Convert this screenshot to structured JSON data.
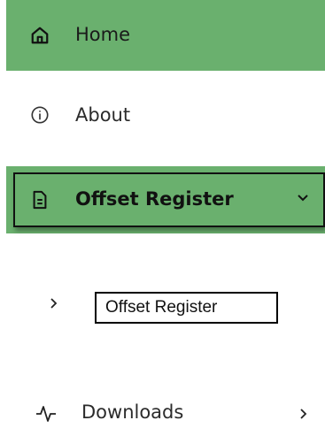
{
  "nav": {
    "home": {
      "label": "Home",
      "icon": "home-icon"
    },
    "about": {
      "label": "About",
      "icon": "info-icon"
    },
    "offset_register": {
      "label": "Offset Register",
      "icon": "document-icon",
      "expanded": true
    },
    "offset_register_sub": {
      "label": "Offset Register"
    },
    "downloads": {
      "label": "Downloads",
      "icon": "activity-icon"
    }
  },
  "colors": {
    "active_bg": "#6ab06e",
    "text": "#2b2b2b"
  }
}
